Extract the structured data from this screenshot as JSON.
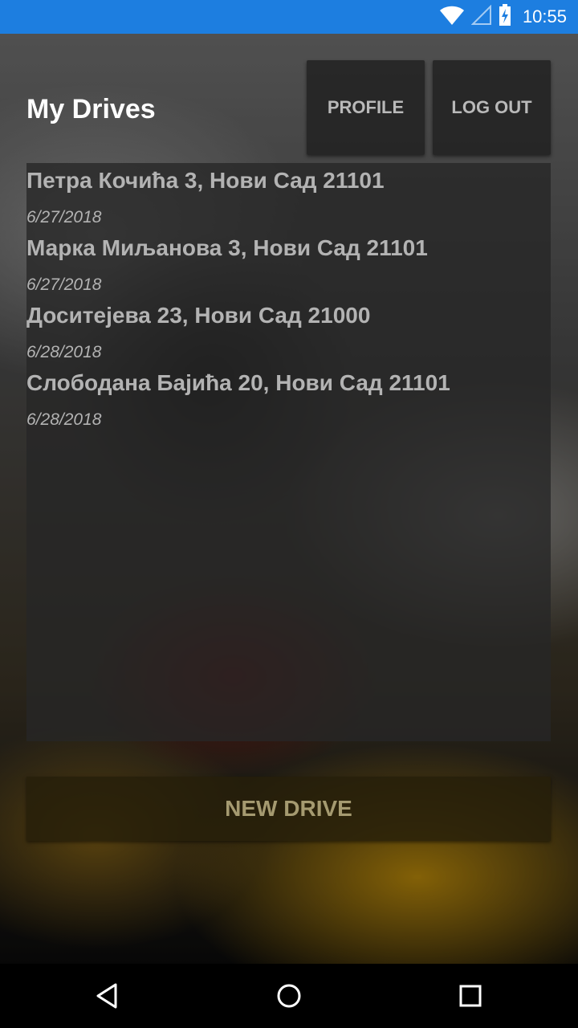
{
  "status_bar": {
    "time": "10:55",
    "icons": [
      "wifi-icon",
      "cell-signal-icon",
      "battery-charging-icon"
    ],
    "color": "#1d7ee0"
  },
  "header": {
    "title": "My Drives",
    "profile_label": "PROFILE",
    "logout_label": "LOG OUT"
  },
  "drives": [
    {
      "address": "Петра Кочића 3, Нови Сад 21101",
      "date": "6/27/2018"
    },
    {
      "address": "Марка Миљанова 3, Нови Сад 21101",
      "date": "6/27/2018"
    },
    {
      "address": "Доситејева 23, Нови Сад 21000",
      "date": "6/28/2018"
    },
    {
      "address": "Слободана Бајића 20, Нови Сад 21101",
      "date": "6/28/2018"
    }
  ],
  "new_drive_label": "NEW DRIVE",
  "nav_bar": {
    "icons": [
      "back-icon",
      "home-icon",
      "recent-apps-icon"
    ]
  }
}
